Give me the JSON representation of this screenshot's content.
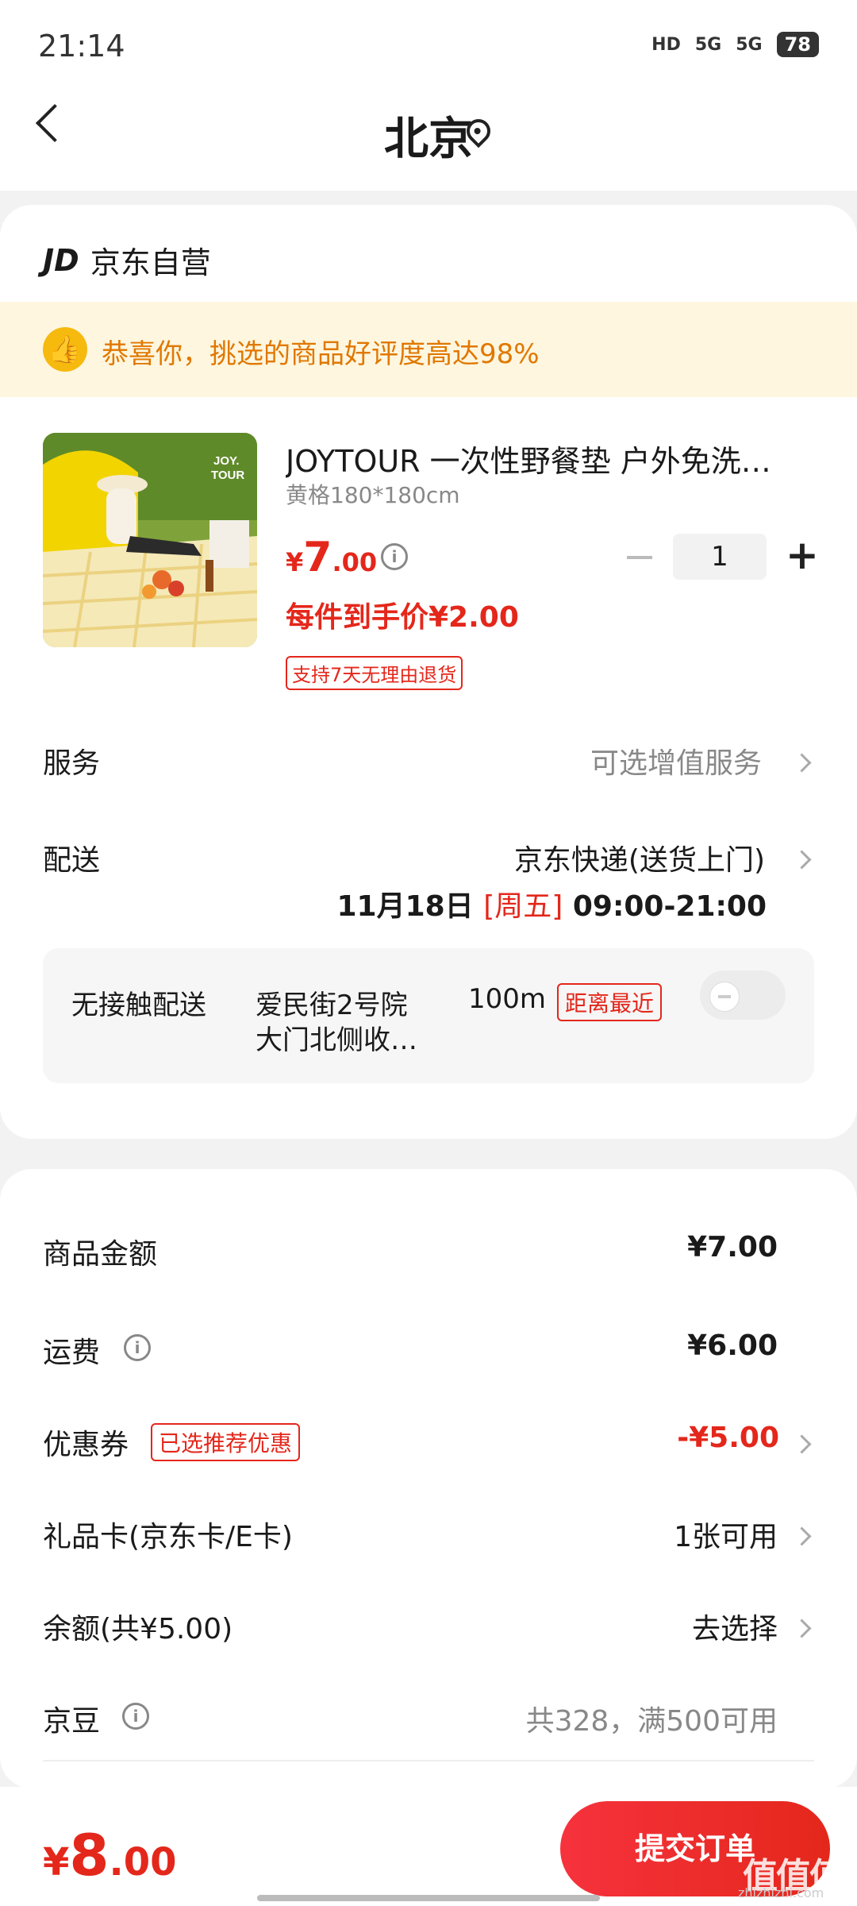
{
  "status_bar": {
    "time": "21:14",
    "hd": "HD",
    "net1": "5G",
    "net2": "5G",
    "battery": "78"
  },
  "header": {
    "city": "北京"
  },
  "shop": {
    "logo": "JD",
    "name": "京东自营"
  },
  "banner": {
    "text": "恭喜你，挑选的商品好评度高达98%"
  },
  "product": {
    "title": "JOYTOUR 一次性野餐垫 户外免洗…",
    "spec": "黄格180*180cm",
    "price_currency": "¥",
    "price_int": "7",
    "price_dec": ".00",
    "quantity": "1",
    "unit_price": "每件到手价¥2.00",
    "return_tag": "支持7天无理由退货",
    "image_text": "JOY.TOUR"
  },
  "service": {
    "label": "服务",
    "value": "可选增值服务"
  },
  "delivery": {
    "label": "配送",
    "method": "京东快递(送货上门)",
    "date": "11月18日",
    "weekday": "[周五]",
    "window": "09:00-21:00",
    "contactless": "无接触配送",
    "address_line1": "爱民街2号院",
    "address_line2": "大门北侧收…",
    "distance": "100m",
    "near_tag": "距离最近"
  },
  "summary": {
    "goods_label": "商品金额",
    "goods_value": "¥7.00",
    "shipping_label": "运费",
    "shipping_value": "¥6.00",
    "coupon_label": "优惠券",
    "coupon_tag": "已选推荐优惠",
    "coupon_value": "-¥5.00",
    "giftcard_label": "礼品卡(京东卡/E卡)",
    "giftcard_value": "1张可用",
    "balance_label": "余额(共¥5.00)",
    "balance_value": "去选择",
    "jingdou_label": "京豆",
    "jingdou_value": "共328，满500可用"
  },
  "footer": {
    "total_currency": "¥",
    "total_int": "8",
    "total_dec": ".00",
    "submit": "提交订单",
    "watermark": "值值值",
    "watermark_url": "zhizhizhi.com"
  },
  "colors": {
    "accent": "#e4271b",
    "banner_bg": "#fef6df",
    "banner_text": "#e07800"
  }
}
